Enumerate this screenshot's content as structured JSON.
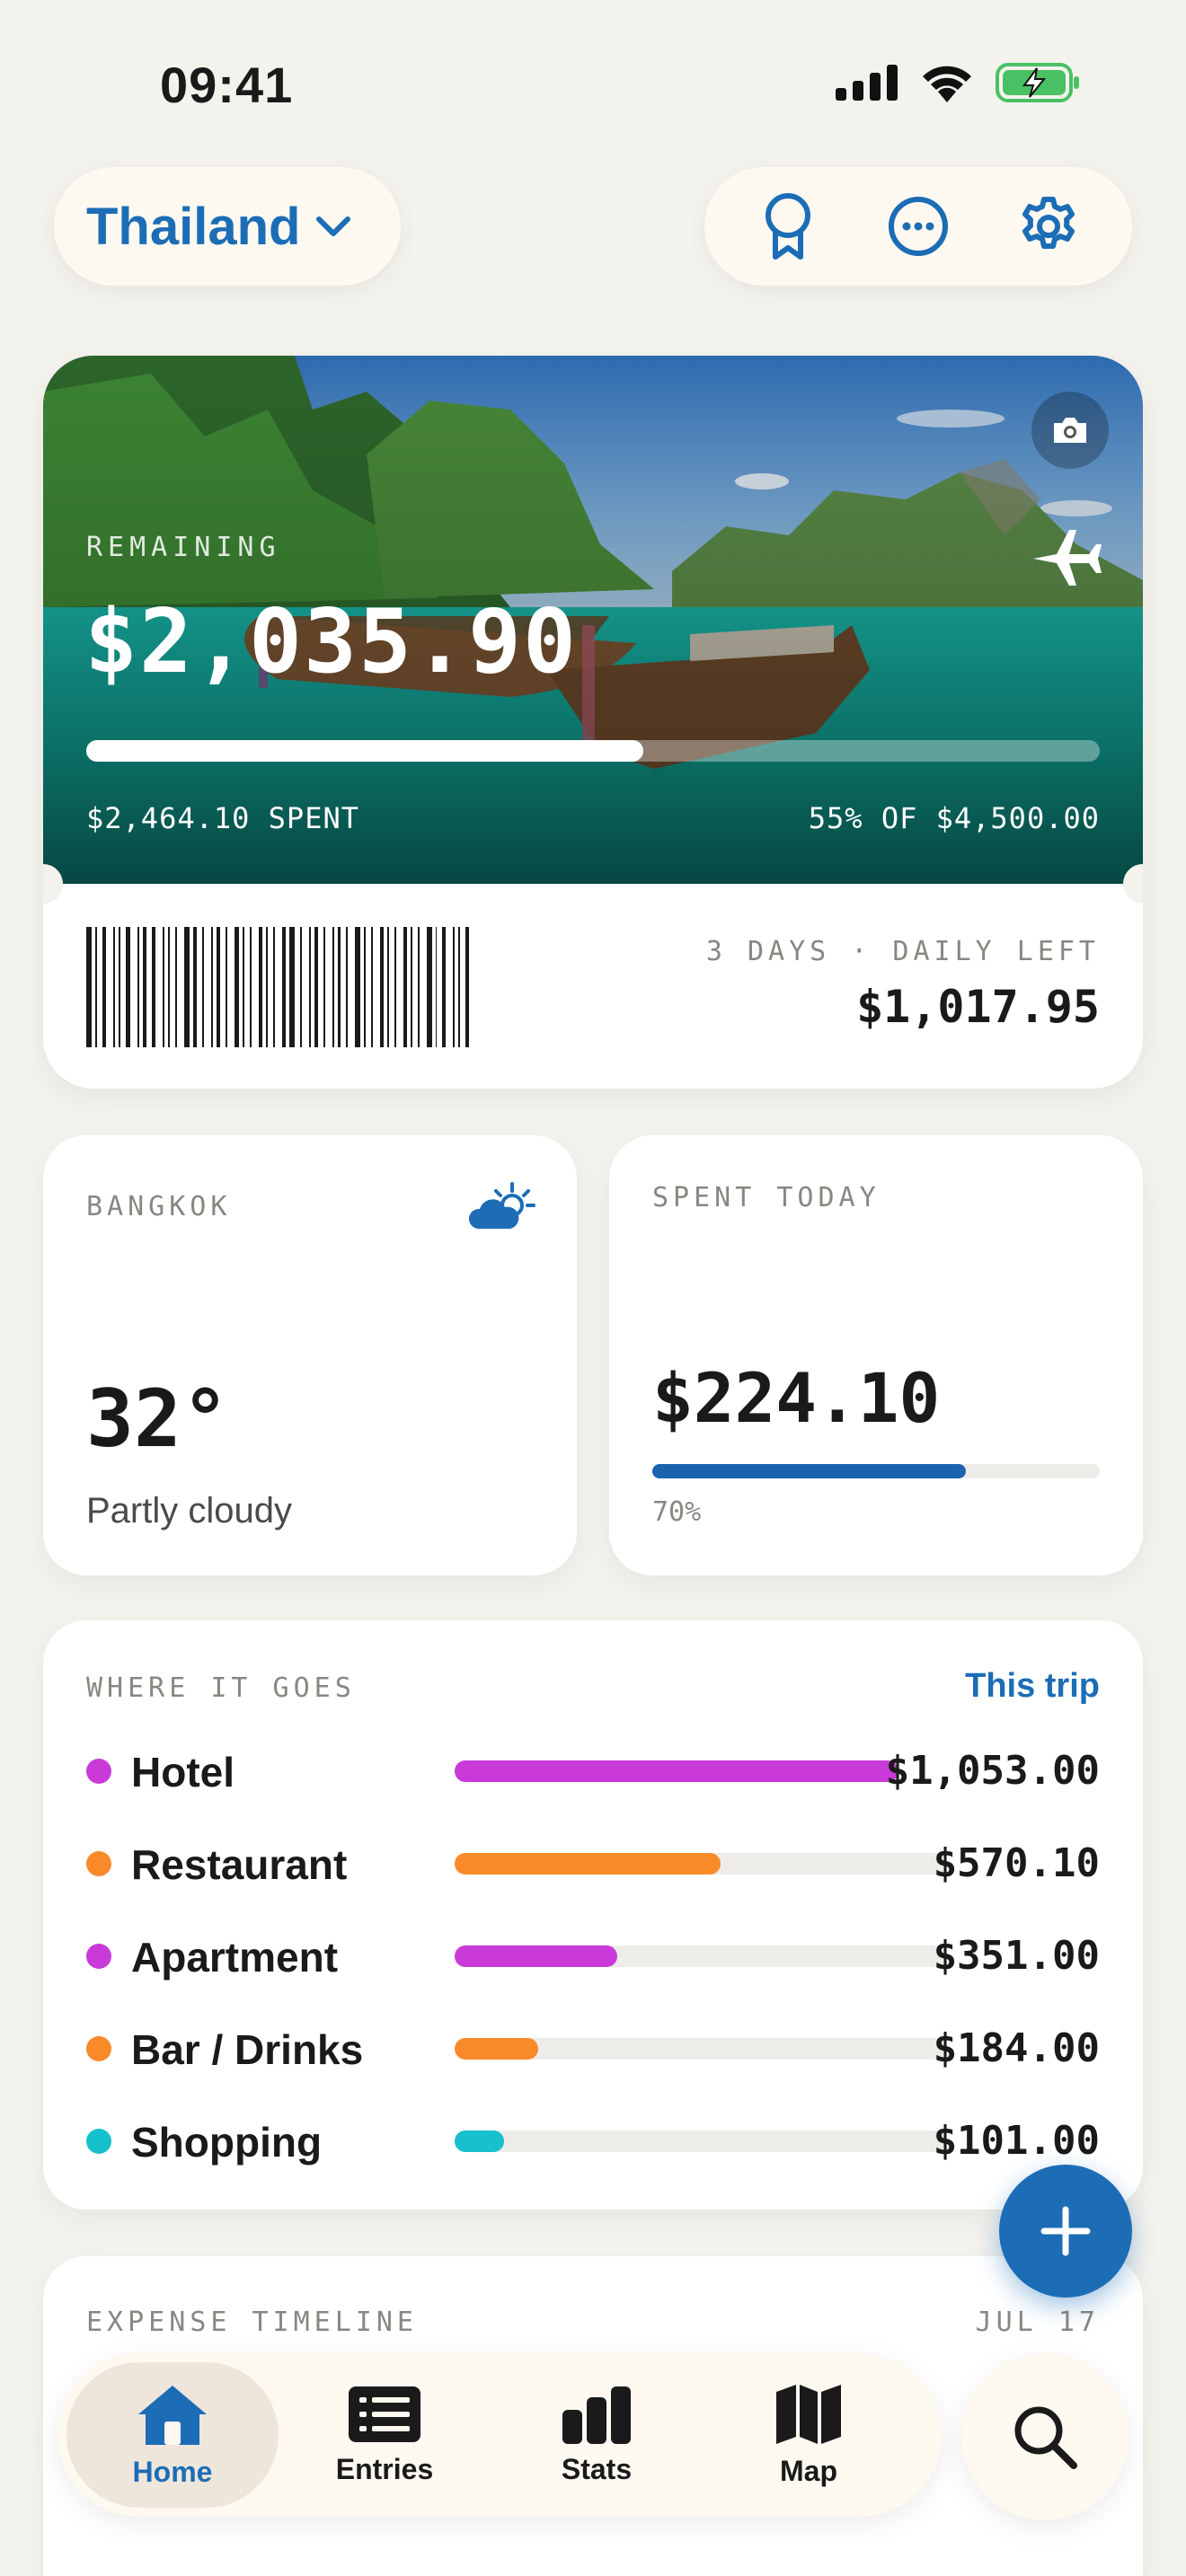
{
  "status": {
    "time": "09:41"
  },
  "header": {
    "trip_name": "Thailand"
  },
  "hero": {
    "remaining_label": "REMAINING",
    "remaining_amount": "$2,035.90",
    "spent_text": "$2,464.10 SPENT",
    "budget_text": "55% OF $4,500.00",
    "progress_fraction": 0.55,
    "daily_label": "3 DAYS · DAILY LEFT",
    "daily_amount": "$1,017.95"
  },
  "weather": {
    "city": "BANGKOK",
    "temperature": "32°",
    "condition": "Partly cloudy"
  },
  "today": {
    "label": "SPENT TODAY",
    "amount": "$224.10",
    "percent_text": "70%",
    "progress_fraction": 0.7
  },
  "breakdown": {
    "title": "WHERE IT GOES",
    "scope_link": "This trip",
    "items": [
      {
        "name": "Hotel",
        "amount": "$1,053.00",
        "fraction": 1.0,
        "color": "#c93ad8"
      },
      {
        "name": "Restaurant",
        "amount": "$570.10",
        "fraction": 0.54,
        "color": "#f98a2a"
      },
      {
        "name": "Apartment",
        "amount": "$351.00",
        "fraction": 0.33,
        "color": "#c93ad8"
      },
      {
        "name": "Bar / Drinks",
        "amount": "$184.00",
        "fraction": 0.17,
        "color": "#f98a2a"
      },
      {
        "name": "Shopping",
        "amount": "$101.00",
        "fraction": 0.1,
        "color": "#16c0cc"
      }
    ]
  },
  "timeline": {
    "title": "EXPENSE TIMELINE",
    "date": "JUL 17"
  },
  "tabs": [
    {
      "label": "Home",
      "icon": "home-icon",
      "active": true
    },
    {
      "label": "Entries",
      "icon": "list-icon",
      "active": false
    },
    {
      "label": "Stats",
      "icon": "bar-chart-icon",
      "active": false
    },
    {
      "label": "Map",
      "icon": "map-icon",
      "active": false
    }
  ],
  "colors": {
    "accent": "#1c6db6",
    "background": "#f4f2ed",
    "card": "#ffffff"
  }
}
